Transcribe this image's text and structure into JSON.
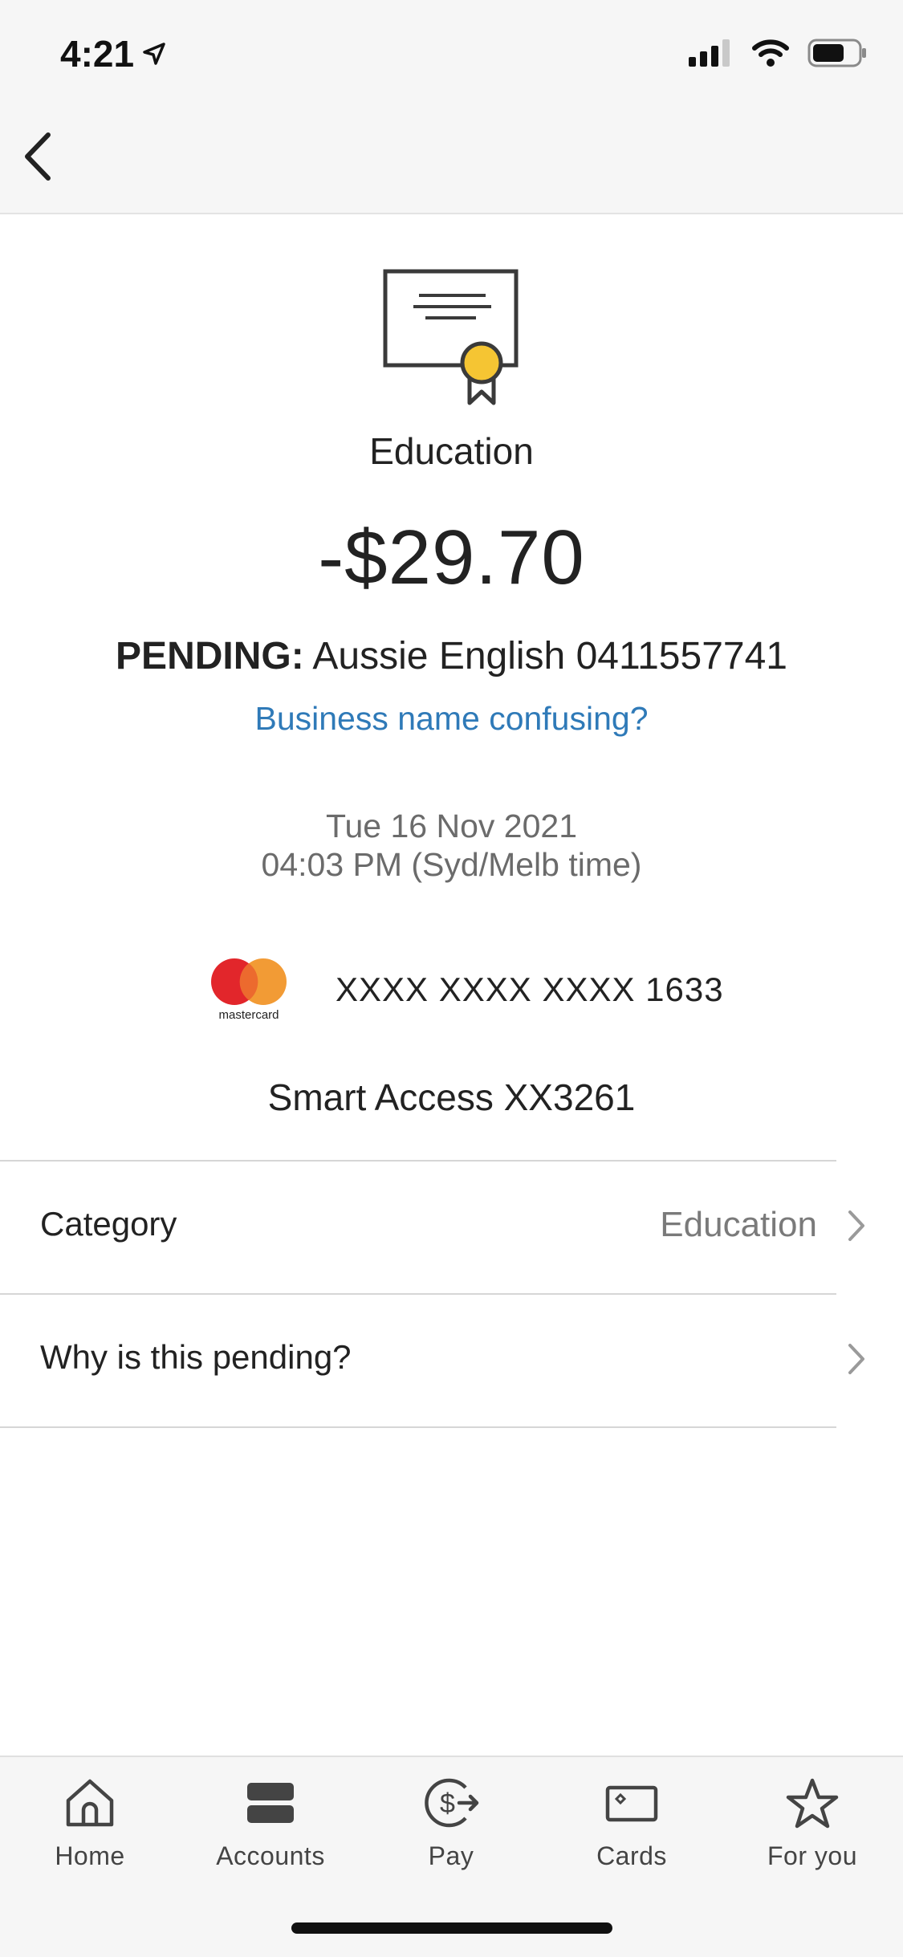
{
  "status_bar": {
    "time": "4:21"
  },
  "header": {
    "back_icon": "chevron-left-icon"
  },
  "transaction": {
    "category_icon": "certificate-icon",
    "category_title": "Education",
    "amount": "-$29.70",
    "pending_label": "PENDING:",
    "merchant": "Aussie English 0411557741",
    "business_link": "Business name confusing?",
    "date": "Tue 16 Nov 2021",
    "time": "04:03 PM (Syd/Melb time)",
    "card_brand_logo_text": "mastercard",
    "card_number": "XXXX XXXX XXXX 1633",
    "account": "Smart Access XX3261"
  },
  "rows": [
    {
      "label": "Category",
      "value": "Education"
    },
    {
      "label": "Why is this pending?",
      "value": ""
    }
  ],
  "tabbar": {
    "tabs": [
      {
        "label": "Home",
        "icon": "home-icon"
      },
      {
        "label": "Accounts",
        "icon": "accounts-icon"
      },
      {
        "label": "Pay",
        "icon": "pay-icon"
      },
      {
        "label": "Cards",
        "icon": "card-icon"
      },
      {
        "label": "For you",
        "icon": "star-icon"
      }
    ]
  },
  "colors": {
    "link": "#2f7ab8",
    "accent_yellow": "#f5c533",
    "mastercard_red": "#e2262b",
    "mastercard_orange": "#f29b35"
  }
}
